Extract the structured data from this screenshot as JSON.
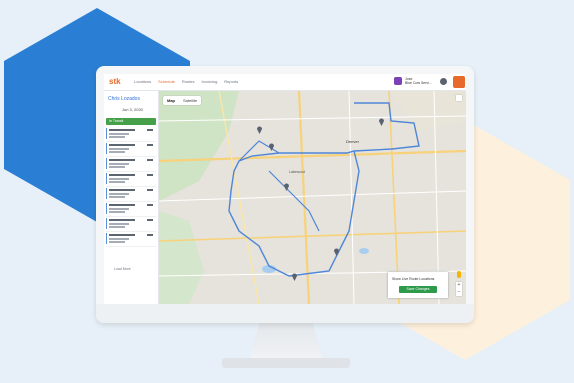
{
  "app": {
    "logo": "stk",
    "nav": [
      "Locations",
      "Schedule",
      "Routes",
      "Invoicing",
      "Reports"
    ],
    "active_nav": "Schedule",
    "user_name": "Jose",
    "user_org": "Blue Cow Servi..."
  },
  "sidebar": {
    "title": "Chris Lozados",
    "date": "Jun 3, 2020",
    "section_label": "In Transit",
    "item_count": 8,
    "footer": "Load More"
  },
  "map": {
    "tabs": [
      "Map",
      "Satellite"
    ],
    "active_tab": "Map",
    "city_labels": [
      "Denver",
      "Lakewood"
    ],
    "panel_check_label": "Show Live Route Locations",
    "panel_button": "Save Changes",
    "zoom_in": "+",
    "zoom_out": "−"
  },
  "colors": {
    "accent": "#e86a2b",
    "route": "#4f86d8",
    "success": "#2e9a4c",
    "hex_blue": "#2a7fd4",
    "hex_peach": "#fdf0dc"
  }
}
